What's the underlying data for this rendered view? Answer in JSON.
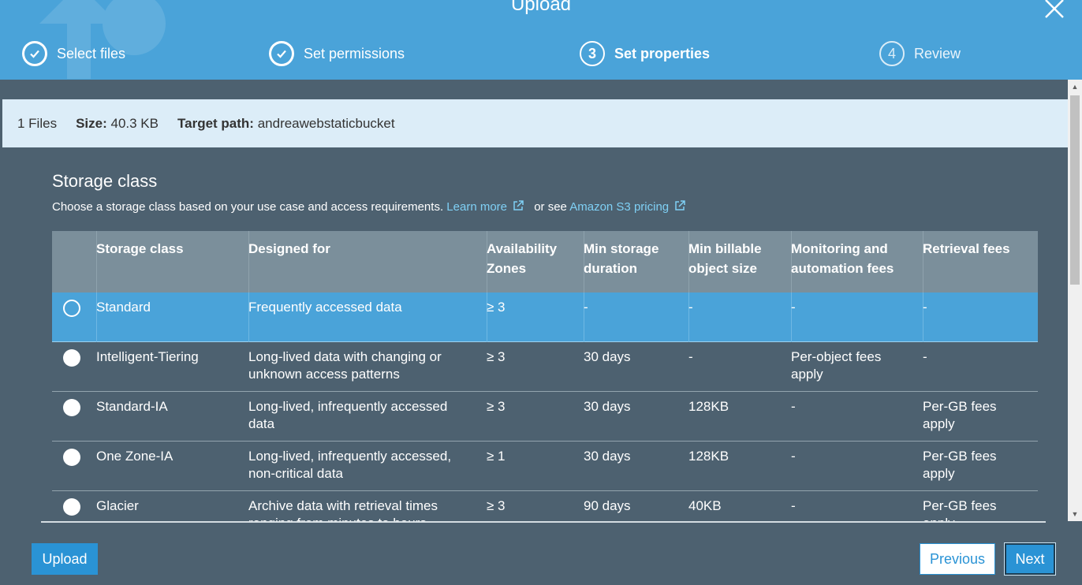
{
  "header": {
    "title": "Upload",
    "steps": [
      {
        "label": "Select files",
        "status": "done"
      },
      {
        "label": "Set permissions",
        "status": "done"
      },
      {
        "label": "Set properties",
        "number": "3",
        "status": "active"
      },
      {
        "label": "Review",
        "number": "4",
        "status": "todo"
      }
    ]
  },
  "info": {
    "files": "1 Files",
    "size_label": "Size:",
    "size_value": "40.3 KB",
    "path_label": "Target path:",
    "path_value": "andreawebstaticbucket"
  },
  "storage": {
    "title": "Storage class",
    "description": "Choose a storage class based on your use case and access requirements.",
    "learn_more": "Learn more",
    "or_see": "or see",
    "pricing_link": "Amazon S3 pricing"
  },
  "table": {
    "headers": {
      "storage_class": "Storage class",
      "designed_for": "Designed for",
      "az_1": "Availability",
      "az_2": "Zones",
      "duration_1": "Min storage",
      "duration_2": "duration",
      "size_1": "Min billable",
      "size_2": "object size",
      "monitoring_1": "Monitoring and",
      "monitoring_2": "automation fees",
      "retrieval": "Retrieval fees"
    },
    "rows": [
      {
        "name": "Standard",
        "designed_1": "Frequently accessed data",
        "designed_2": "",
        "az": "≥ 3",
        "duration": "-",
        "size": "-",
        "monitoring_1": "-",
        "monitoring_2": "",
        "retrieval_1": "-",
        "retrieval_2": "",
        "selected": true
      },
      {
        "name": "Intelligent-Tiering",
        "designed_1": "Long-lived data with changing or",
        "designed_2": "unknown access patterns",
        "az": "≥ 3",
        "duration": "30 days",
        "size": "-",
        "monitoring_1": "Per-object fees",
        "monitoring_2": "apply",
        "retrieval_1": "-",
        "retrieval_2": "",
        "selected": false
      },
      {
        "name": "Standard-IA",
        "designed_1": "Long-lived, infrequently accessed",
        "designed_2": "data",
        "az": "≥ 3",
        "duration": "30 days",
        "size": "128KB",
        "monitoring_1": "-",
        "monitoring_2": "",
        "retrieval_1": "Per-GB fees",
        "retrieval_2": "apply",
        "selected": false
      },
      {
        "name": "One Zone-IA",
        "designed_1": "Long-lived, infrequently accessed,",
        "designed_2": "non-critical data",
        "az": "≥ 1",
        "duration": "30 days",
        "size": "128KB",
        "monitoring_1": "-",
        "monitoring_2": "",
        "retrieval_1": "Per-GB fees",
        "retrieval_2": "apply",
        "selected": false
      },
      {
        "name": "Glacier",
        "designed_1": "Archive data with retrieval times",
        "designed_2": "ranging from minutes to hours",
        "az": "≥ 3",
        "duration": "90 days",
        "size": "40KB",
        "monitoring_1": "-",
        "monitoring_2": "",
        "retrieval_1": "Per-GB fees",
        "retrieval_2": "apply",
        "selected": false
      }
    ]
  },
  "buttons": {
    "upload": "Upload",
    "previous": "Previous",
    "next": "Next"
  },
  "colors": {
    "header_blue": "#4aa3d9",
    "background": "#4d6170",
    "button_blue": "#2a93d5",
    "info_bar": "#dcedf8"
  }
}
